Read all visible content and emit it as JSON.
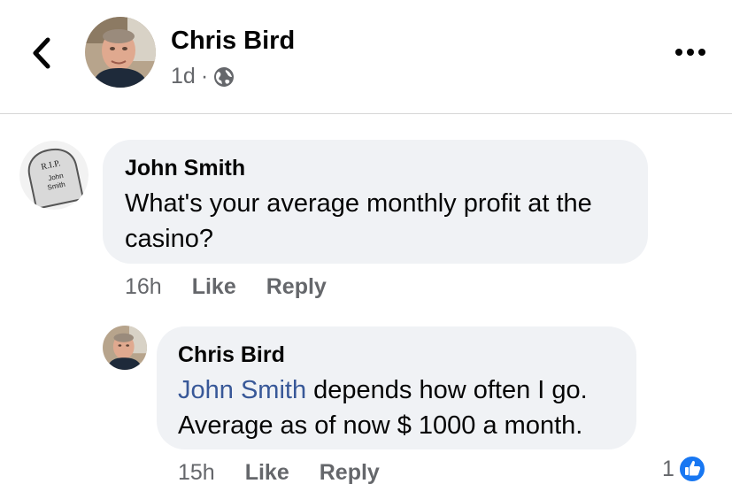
{
  "header": {
    "author": "Chris Bird",
    "time": "1d",
    "separator": "·",
    "privacy_icon": "globe-icon",
    "back_icon": "chevron-left-icon",
    "more_icon": "more-horizontal-icon"
  },
  "comments": [
    {
      "author": "John Smith",
      "text_line1": "What's your average monthly profit at the",
      "text_line2": "casino?",
      "time": "16h",
      "like_label": "Like",
      "reply_label": "Reply",
      "avatar_lines": [
        "R.I.P.",
        "John",
        "Smith"
      ]
    },
    {
      "author": "Chris Bird",
      "mention": "John Smith",
      "text_line1_rest": " depends how often I go.",
      "text_line2": "Average as of now $ 1000 a month.",
      "time": "15h",
      "like_label": "Like",
      "reply_label": "Reply",
      "reaction_count": "1",
      "reaction_icon": "thumbs-up-icon"
    }
  ],
  "colors": {
    "bubble": "#f0f2f5",
    "secondary_text": "#65676b",
    "mention": "#385898",
    "like_blue": "#1877f2"
  }
}
